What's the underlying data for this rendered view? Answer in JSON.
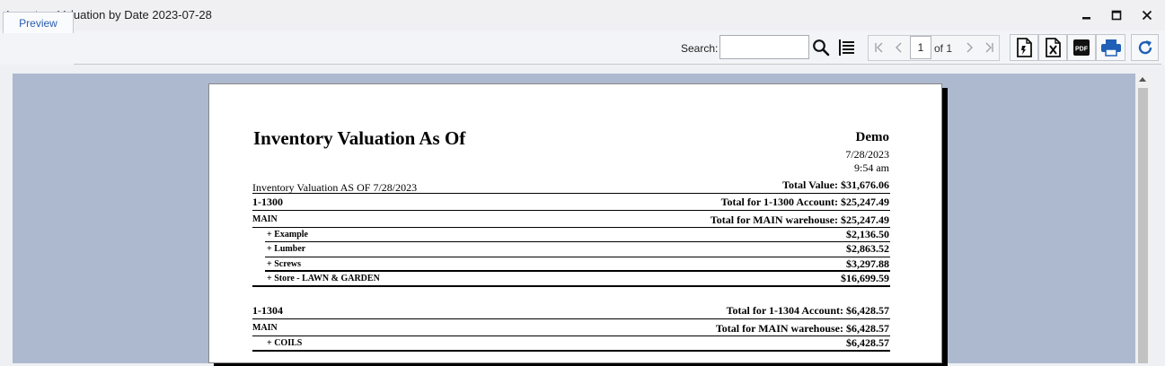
{
  "window": {
    "title": "Inventory Valuation by Date 2023-07-28"
  },
  "tabs": [
    {
      "label": "Preview"
    }
  ],
  "toolbar": {
    "search_label": "Search:",
    "search_value": "",
    "page_current": "1",
    "page_of": "of 1",
    "export_icons": [
      "rtf-export-icon",
      "excel-export-icon",
      "pdf-export-icon",
      "print-icon",
      "refresh-icon"
    ]
  },
  "report": {
    "title": "Inventory Valuation As Of",
    "company": "Demo",
    "date": "7/28/2023",
    "time": "9:54 am",
    "subtitle": "Inventory Valuation AS OF 7/28/2023",
    "total_value": "Total Value: $31,676.06",
    "accounts": [
      {
        "number": "1-1300",
        "total": "Total for 1-1300 Account: $25,247.49",
        "warehouse": "MAIN",
        "warehouse_total": "Total for MAIN warehouse: $25,247.49",
        "items": [
          {
            "name": "+ Example",
            "value": "$2,136.50"
          },
          {
            "name": "+ Lumber",
            "value": "$2,863.52"
          },
          {
            "name": "+ Screws",
            "value": "$3,297.88"
          },
          {
            "name": "+ Store - LAWN & GARDEN",
            "value": "$16,699.59"
          }
        ]
      },
      {
        "number": "1-1304",
        "total": "Total for 1-1304 Account: $6,428.57",
        "warehouse": "MAIN",
        "warehouse_total": "Total for MAIN warehouse: $6,428.57",
        "items": [
          {
            "name": "+ COILS",
            "value": "$6,428.57"
          }
        ]
      }
    ]
  }
}
